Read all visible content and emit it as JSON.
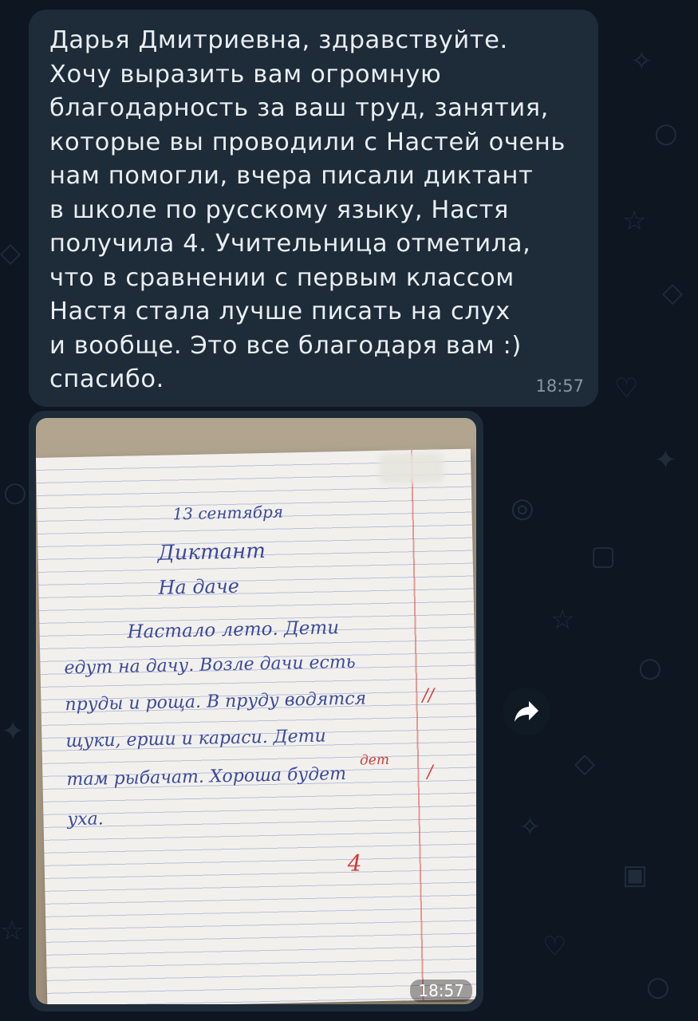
{
  "chat": {
    "message_text": "Дарья Дмитриевна, здравствуйте.\nХочу выразить вам огромную\nблагодарность за ваш труд, занятия,\nкоторые вы проводили с Настей очень\nнам помогли, вчера писали диктант\nв школе по русскому языку, Настя\nполучила 4. Учительница отметила,\nчто в сравнении с первым классом\nНастя стала лучше писать на слух\nи вообще. Это все благодаря вам :)\nспасибо.",
    "message_time": "18:57",
    "photo_time": "18:57"
  },
  "dictation": {
    "date": "13 сентября",
    "title": "Диктант",
    "subtitle": "На даче",
    "lines": [
      "Настало лето. Дети",
      "едут на дачу. Возле дачи есть",
      "пруды и роща. В пруду водятся",
      "щуки, ерши и караси. Дети",
      "там рыбачат. Хороша будет",
      "уха."
    ],
    "grade": "4",
    "margin_marks": [
      "//",
      "/"
    ],
    "correction": "дет"
  },
  "icons": {
    "share": "share-arrow-icon"
  },
  "colors": {
    "background": "#0e1621",
    "bubble": "#1e2b38",
    "text": "#e9eef3",
    "time": "#8796a5",
    "ink": "#3b4a9a",
    "red_ink": "#d23a3a"
  }
}
